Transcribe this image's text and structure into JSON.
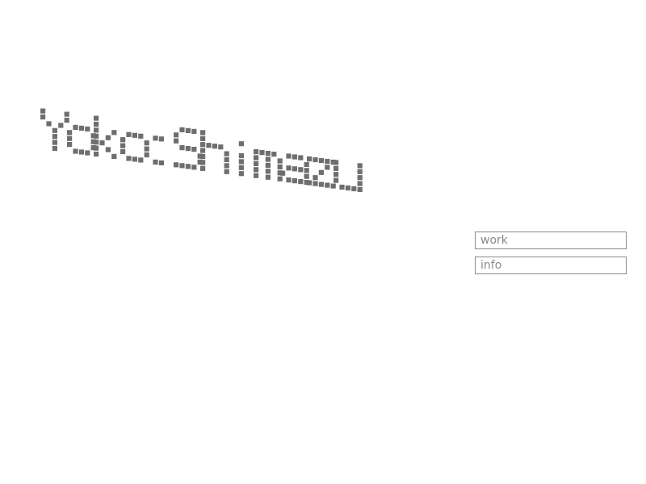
{
  "logo": {
    "text": "Yoko Shimazu",
    "color": "#6e6e6e"
  },
  "nav": {
    "items": [
      {
        "label": "work"
      },
      {
        "label": "info"
      }
    ],
    "border_color": "#8a8a8a",
    "text_color": "#8a8a8a"
  }
}
